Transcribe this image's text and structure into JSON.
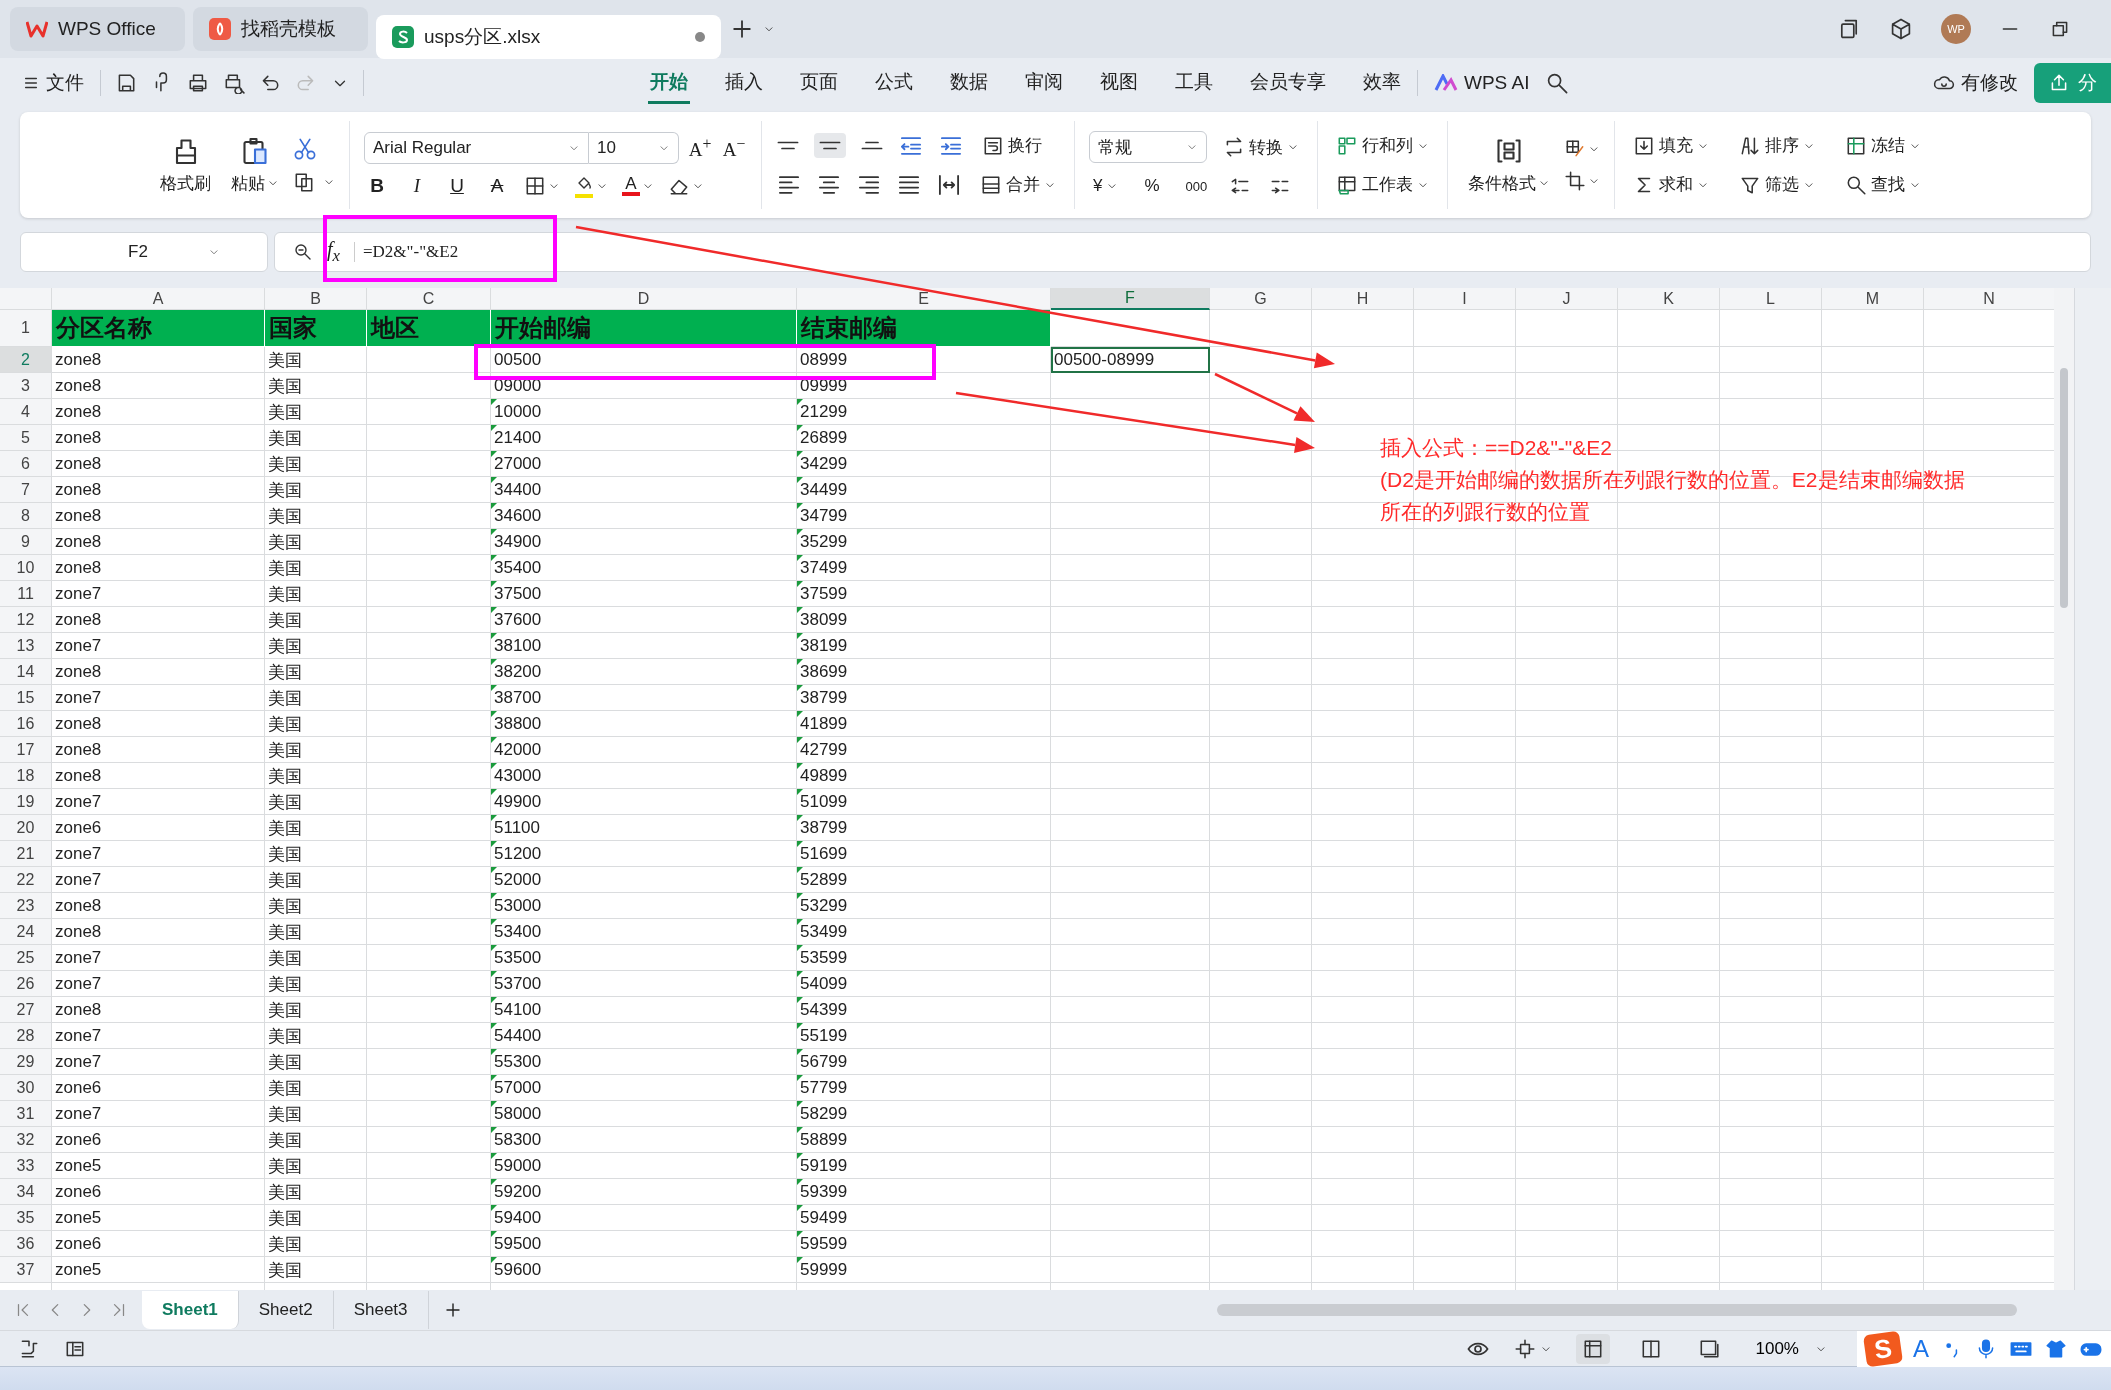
{
  "title_tabs": [
    {
      "label": "WPS Office",
      "kind": "home",
      "selected": false
    },
    {
      "label": "找稻壳模板",
      "kind": "template",
      "selected": false
    },
    {
      "label": "usps分区.xlsx",
      "kind": "sheet",
      "selected": true,
      "modified": true
    }
  ],
  "avatar": "WP",
  "menu": {
    "file": "文件",
    "tabs": [
      {
        "label": "开始",
        "selected": true
      },
      {
        "label": "插入",
        "selected": false
      },
      {
        "label": "页面",
        "selected": false
      },
      {
        "label": "公式",
        "selected": false
      },
      {
        "label": "数据",
        "selected": false
      },
      {
        "label": "审阅",
        "selected": false
      },
      {
        "label": "视图",
        "selected": false
      },
      {
        "label": "工具",
        "selected": false
      },
      {
        "label": "会员专享",
        "selected": false
      },
      {
        "label": "效率",
        "selected": false
      }
    ],
    "ai": "WPS AI",
    "save_status": "有修改",
    "share": "分"
  },
  "ribbon": {
    "format_painter": "格式刷",
    "paste": "粘贴",
    "font": "Arial Regular",
    "size": "10",
    "grow": {
      "letter": "A",
      "sign": "+"
    },
    "shrink": {
      "letter": "A",
      "sign": "−"
    },
    "styles": [
      {
        "label": "B",
        "kind": "bold"
      },
      {
        "label": "I",
        "kind": "italic"
      },
      {
        "label": "U",
        "kind": "underline"
      },
      {
        "label": "A",
        "kind": "strike"
      }
    ],
    "font_color": "A",
    "wrap": "换行",
    "merge": "合并",
    "number_format": "常规",
    "convert": "转换",
    "currency": "¥",
    "percent": "%",
    "thousands": "000",
    "rows_cols": "行和列",
    "worksheet": "工作表",
    "conditional": "条件格式",
    "fill": "填充",
    "sum": "求和",
    "sort": "排序",
    "filter": "筛选",
    "freeze": "冻结",
    "find": "查找"
  },
  "formula_bar": {
    "name_box": "F2",
    "fx": "f$_{x}$",
    "formula": "=D2&\"-\"&E2"
  },
  "columns": [
    {
      "label": "A",
      "selected": false
    },
    {
      "label": "B",
      "selected": false
    },
    {
      "label": "C",
      "selected": false
    },
    {
      "label": "D",
      "selected": false
    },
    {
      "label": "E",
      "selected": false
    },
    {
      "label": "F",
      "selected": true
    },
    {
      "label": "G",
      "selected": false
    },
    {
      "label": "H",
      "selected": false
    },
    {
      "label": "I",
      "selected": false
    },
    {
      "label": "J",
      "selected": false
    },
    {
      "label": "K",
      "selected": false
    },
    {
      "label": "L",
      "selected": false
    },
    {
      "label": "M",
      "selected": false
    },
    {
      "label": "N",
      "selected": false
    }
  ],
  "header_row": {
    "num": "1",
    "cells": [
      "分区名称",
      "国家",
      "地区",
      "开始邮编",
      "结束邮编"
    ]
  },
  "rows": [
    {
      "num": "2",
      "zone": "zone8",
      "country": "美国",
      "start": "00500",
      "end": "08999",
      "result": "00500-08999",
      "selected": true,
      "text_number": false
    },
    {
      "num": "3",
      "zone": "zone8",
      "country": "美国",
      "start": "09000",
      "end": "09999",
      "selected": false,
      "text_number": false
    },
    {
      "num": "4",
      "zone": "zone8",
      "country": "美国",
      "start": "10000",
      "end": "21299",
      "selected": false,
      "text_number": true
    },
    {
      "num": "5",
      "zone": "zone8",
      "country": "美国",
      "start": "21400",
      "end": "26899",
      "selected": false,
      "text_number": true
    },
    {
      "num": "6",
      "zone": "zone8",
      "country": "美国",
      "start": "27000",
      "end": "34299",
      "selected": false,
      "text_number": true
    },
    {
      "num": "7",
      "zone": "zone8",
      "country": "美国",
      "start": "34400",
      "end": "34499",
      "selected": false,
      "text_number": true
    },
    {
      "num": "8",
      "zone": "zone8",
      "country": "美国",
      "start": "34600",
      "end": "34799",
      "selected": false,
      "text_number": true
    },
    {
      "num": "9",
      "zone": "zone8",
      "country": "美国",
      "start": "34900",
      "end": "35299",
      "selected": false,
      "text_number": true
    },
    {
      "num": "10",
      "zone": "zone8",
      "country": "美国",
      "start": "35400",
      "end": "37499",
      "selected": false,
      "text_number": true
    },
    {
      "num": "11",
      "zone": "zone7",
      "country": "美国",
      "start": "37500",
      "end": "37599",
      "selected": false,
      "text_number": true
    },
    {
      "num": "12",
      "zone": "zone8",
      "country": "美国",
      "start": "37600",
      "end": "38099",
      "selected": false,
      "text_number": true
    },
    {
      "num": "13",
      "zone": "zone7",
      "country": "美国",
      "start": "38100",
      "end": "38199",
      "selected": false,
      "text_number": true
    },
    {
      "num": "14",
      "zone": "zone8",
      "country": "美国",
      "start": "38200",
      "end": "38699",
      "selected": false,
      "text_number": true
    },
    {
      "num": "15",
      "zone": "zone7",
      "country": "美国",
      "start": "38700",
      "end": "38799",
      "selected": false,
      "text_number": true
    },
    {
      "num": "16",
      "zone": "zone8",
      "country": "美国",
      "start": "38800",
      "end": "41899",
      "selected": false,
      "text_number": true
    },
    {
      "num": "17",
      "zone": "zone8",
      "country": "美国",
      "start": "42000",
      "end": "42799",
      "selected": false,
      "text_number": true
    },
    {
      "num": "18",
      "zone": "zone8",
      "country": "美国",
      "start": "43000",
      "end": "49899",
      "selected": false,
      "text_number": true
    },
    {
      "num": "19",
      "zone": "zone7",
      "country": "美国",
      "start": "49900",
      "end": "51099",
      "selected": false,
      "text_number": true
    },
    {
      "num": "20",
      "zone": "zone6",
      "country": "美国",
      "start": "51100",
      "end": "38799",
      "selected": false,
      "text_number": true
    },
    {
      "num": "21",
      "zone": "zone7",
      "country": "美国",
      "start": "51200",
      "end": "51699",
      "selected": false,
      "text_number": true
    },
    {
      "num": "22",
      "zone": "zone7",
      "country": "美国",
      "start": "52000",
      "end": "52899",
      "selected": false,
      "text_number": true
    },
    {
      "num": "23",
      "zone": "zone8",
      "country": "美国",
      "start": "53000",
      "end": "53299",
      "selected": false,
      "text_number": true
    },
    {
      "num": "24",
      "zone": "zone8",
      "country": "美国",
      "start": "53400",
      "end": "53499",
      "selected": false,
      "text_number": true
    },
    {
      "num": "25",
      "zone": "zone7",
      "country": "美国",
      "start": "53500",
      "end": "53599",
      "selected": false,
      "text_number": true
    },
    {
      "num": "26",
      "zone": "zone7",
      "country": "美国",
      "start": "53700",
      "end": "54099",
      "selected": false,
      "text_number": true
    },
    {
      "num": "27",
      "zone": "zone8",
      "country": "美国",
      "start": "54100",
      "end": "54399",
      "selected": false,
      "text_number": true
    },
    {
      "num": "28",
      "zone": "zone7",
      "country": "美国",
      "start": "54400",
      "end": "55199",
      "selected": false,
      "text_number": true
    },
    {
      "num": "29",
      "zone": "zone7",
      "country": "美国",
      "start": "55300",
      "end": "56799",
      "selected": false,
      "text_number": true
    },
    {
      "num": "30",
      "zone": "zone6",
      "country": "美国",
      "start": "57000",
      "end": "57799",
      "selected": false,
      "text_number": true
    },
    {
      "num": "31",
      "zone": "zone7",
      "country": "美国",
      "start": "58000",
      "end": "58299",
      "selected": false,
      "text_number": true
    },
    {
      "num": "32",
      "zone": "zone6",
      "country": "美国",
      "start": "58300",
      "end": "58899",
      "selected": false,
      "text_number": true
    },
    {
      "num": "33",
      "zone": "zone5",
      "country": "美国",
      "start": "59000",
      "end": "59199",
      "selected": false,
      "text_number": true
    },
    {
      "num": "34",
      "zone": "zone6",
      "country": "美国",
      "start": "59200",
      "end": "59399",
      "selected": false,
      "text_number": true
    },
    {
      "num": "35",
      "zone": "zone5",
      "country": "美国",
      "start": "59400",
      "end": "59499",
      "selected": false,
      "text_number": true
    },
    {
      "num": "36",
      "zone": "zone6",
      "country": "美国",
      "start": "59500",
      "end": "59599",
      "selected": false,
      "text_number": true
    },
    {
      "num": "37",
      "zone": "zone5",
      "country": "美国",
      "start": "59600",
      "end": "59999",
      "selected": false,
      "text_number": true
    }
  ],
  "annotation": {
    "lines": [
      "插入公式：==D2&\"-\"&E2",
      "(D2是开始邮编的数据所在列跟行数的位置。E2是结束邮编数据",
      "所在的列跟行数的位置"
    ]
  },
  "sheets": [
    {
      "label": "Sheet1",
      "selected": true
    },
    {
      "label": "Sheet2",
      "selected": false
    },
    {
      "label": "Sheet3",
      "selected": false
    }
  ],
  "status_bar": {
    "zoom": "100%",
    "views": [
      {
        "kind": "normal",
        "selected": true
      },
      {
        "kind": "pagebreak",
        "selected": false
      },
      {
        "kind": "pagelayout",
        "selected": false
      }
    ]
  },
  "ime": {
    "logo": "S",
    "mode": "A"
  }
}
